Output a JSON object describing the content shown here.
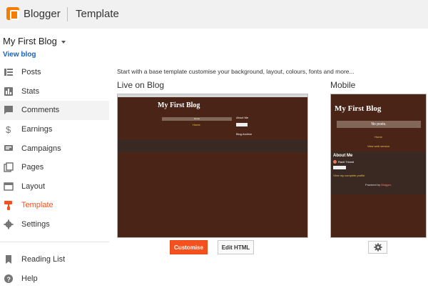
{
  "header": {
    "brand": "Blogger",
    "section": "Template"
  },
  "blog": {
    "name": "My First Blog",
    "view_link": "View blog"
  },
  "sidebar": {
    "items": [
      {
        "label": "Posts",
        "icon": "posts-icon"
      },
      {
        "label": "Stats",
        "icon": "stats-icon"
      },
      {
        "label": "Comments",
        "icon": "comments-icon"
      },
      {
        "label": "Earnings",
        "icon": "earnings-icon"
      },
      {
        "label": "Campaigns",
        "icon": "campaigns-icon"
      },
      {
        "label": "Pages",
        "icon": "pages-icon"
      },
      {
        "label": "Layout",
        "icon": "layout-icon"
      },
      {
        "label": "Template",
        "icon": "template-icon"
      },
      {
        "label": "Settings",
        "icon": "settings-icon"
      }
    ],
    "secondary": [
      {
        "label": "Reading List",
        "icon": "bookmark-icon"
      },
      {
        "label": "Help",
        "icon": "help-icon"
      }
    ]
  },
  "main": {
    "intro": "Start with a base template customise your background, layout, colours, fonts and more...",
    "live_heading": "Live on Blog",
    "mobile_heading": "Mobile",
    "customise_label": "Customise",
    "edit_html_label": "Edit HTML"
  },
  "preview": {
    "title": "My First Blog",
    "home": "Home",
    "about": "About Me",
    "archive": "Blog Archive"
  },
  "mobile": {
    "title": "My First Blog",
    "no_posts": "No posts.",
    "home": "Home",
    "web_version": "View web version",
    "about": "About Me",
    "author": "Ranit Trivedi",
    "profile_link": "View my complete profile",
    "powered_prefix": "Powered by ",
    "powered_brand": "Blogger",
    "powered_suffix": "."
  },
  "colors": {
    "accent": "#f4511e",
    "brand": "#f57d00",
    "link": "#1565c0"
  }
}
